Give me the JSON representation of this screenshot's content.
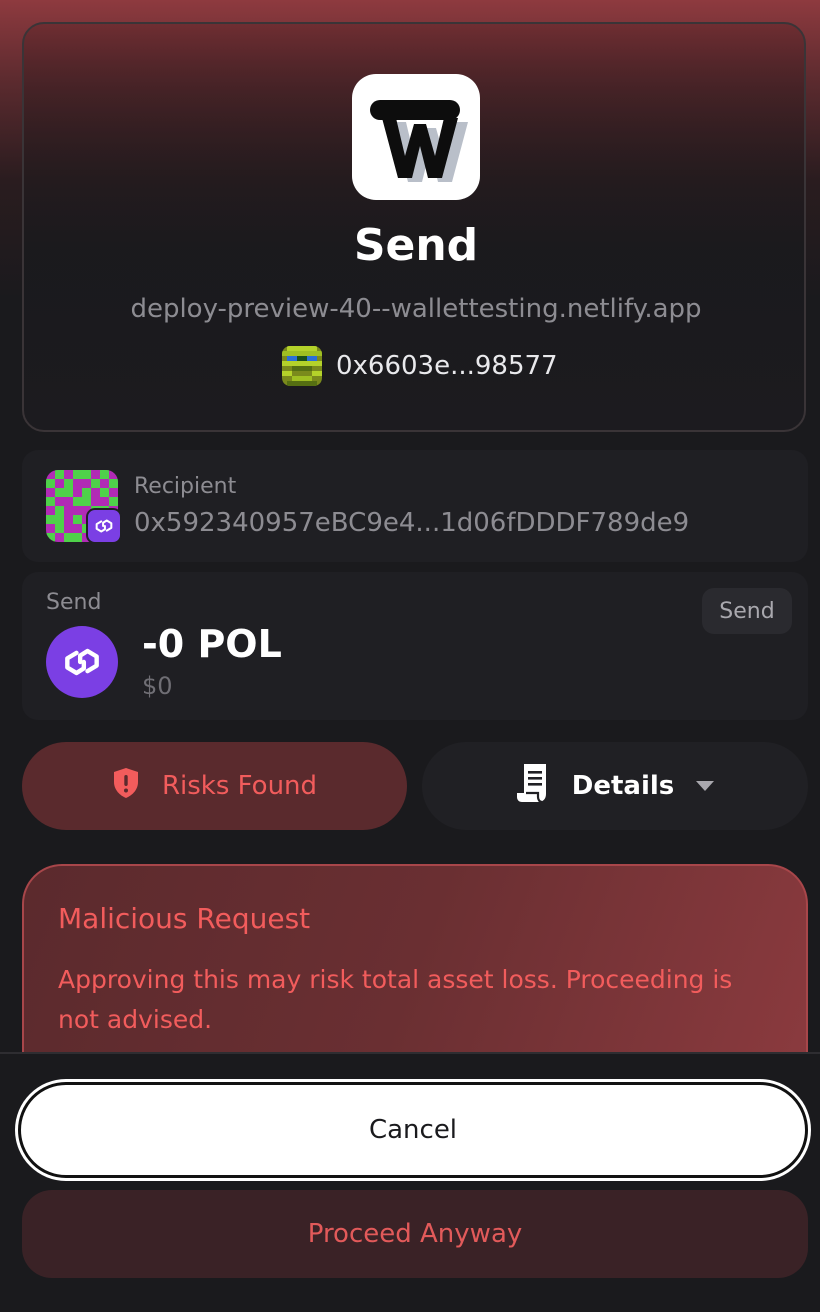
{
  "header": {
    "title": "Send",
    "origin": "deploy-preview-40--wallettesting.netlify.app",
    "account_address": "0x6603e...98577",
    "app_logo_icon": "wallet-app-logo-icon"
  },
  "recipient": {
    "label": "Recipient",
    "address": "0x592340957eBC9e4...1d06fDDDF789de9",
    "chain_icon": "polygon-icon"
  },
  "send": {
    "label": "Send",
    "type_pill": "Send",
    "amount": "-0 POL",
    "fiat": "$0",
    "token_icon": "polygon-icon"
  },
  "actions": {
    "risks_label": "Risks Found",
    "details_label": "Details"
  },
  "alert": {
    "title": "Malicious Request",
    "message": "Approving this may risk total asset loss. Proceeding is not advised."
  },
  "footer": {
    "cancel_label": "Cancel",
    "proceed_label": "Proceed Anyway"
  },
  "colors": {
    "danger": "#f25c5c",
    "polygon": "#7b3fe4",
    "background": "#1a1a1d"
  }
}
